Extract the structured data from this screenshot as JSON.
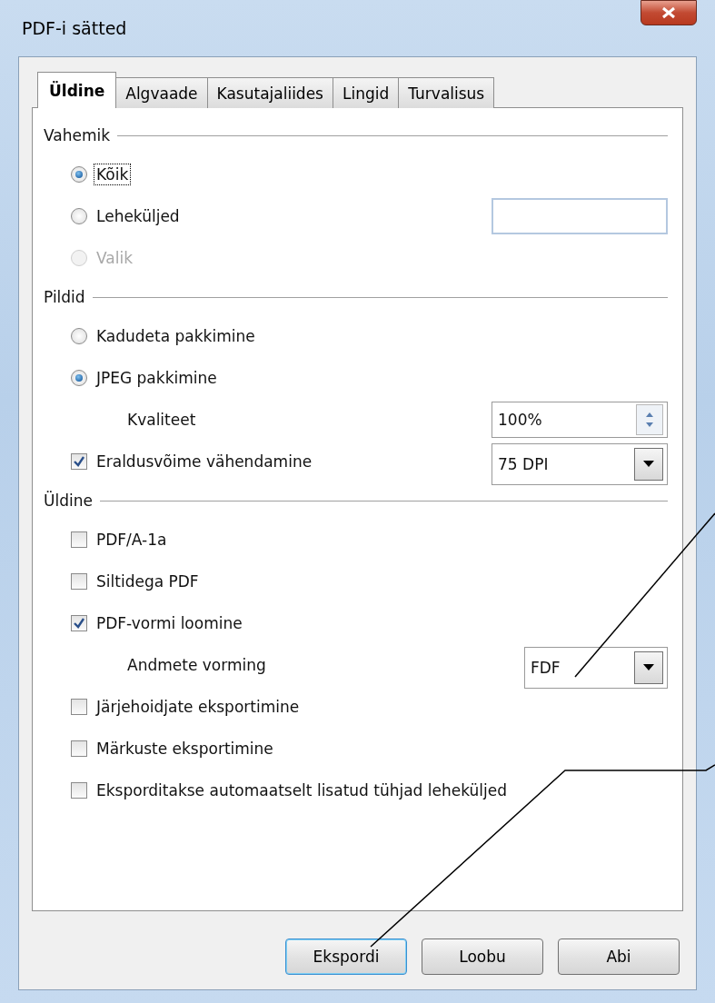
{
  "window": {
    "title": "PDF-i sätted"
  },
  "tabs": [
    {
      "label": "Üldine",
      "selected": true
    },
    {
      "label": "Algvaade",
      "selected": false
    },
    {
      "label": "Kasutajaliides",
      "selected": false
    },
    {
      "label": "Lingid",
      "selected": false
    },
    {
      "label": "Turvalisus",
      "selected": false
    }
  ],
  "sections": [
    {
      "title": "Vahemik",
      "items": [
        {
          "kind": "radio",
          "label": "Kõik",
          "selected": true,
          "disabled": false,
          "focused": true
        },
        {
          "kind": "radio",
          "label": "Leheküljed",
          "selected": false,
          "disabled": false,
          "control": {
            "kind": "text"
          }
        },
        {
          "kind": "radio",
          "label": "Valik",
          "selected": false,
          "disabled": true
        }
      ]
    },
    {
      "title": "Pildid",
      "items": [
        {
          "kind": "radio",
          "label": "Kadudeta pakkimine",
          "selected": false,
          "disabled": false
        },
        {
          "kind": "radio",
          "label": "JPEG pakkimine",
          "selected": true,
          "disabled": false,
          "children": [
            {
              "label": "Kvaliteet",
              "control": {
                "kind": "spin",
                "value": "100%"
              }
            }
          ]
        },
        {
          "kind": "checkbox",
          "label": "Eraldusvõime vähendamine",
          "checked": true,
          "control": {
            "kind": "dropdown",
            "value": "75 DPI"
          }
        }
      ]
    },
    {
      "title": "Üldine",
      "items": [
        {
          "kind": "checkbox",
          "label": "PDF/A-1a",
          "checked": false
        },
        {
          "kind": "checkbox",
          "label": "Siltidega PDF",
          "checked": false
        },
        {
          "kind": "checkbox",
          "label": "PDF-vormi loomine",
          "checked": true,
          "children": [
            {
              "label": "Andmete vorming",
              "control": {
                "kind": "dropdown",
                "value": "FDF",
                "narrow": true
              }
            }
          ]
        },
        {
          "kind": "checkbox",
          "label": "Järjehoidjate eksportimine",
          "checked": false
        },
        {
          "kind": "checkbox",
          "label": "Märkuste eksportimine",
          "checked": false
        },
        {
          "kind": "checkbox",
          "label": "Eksporditakse automaatselt lisatud tühjad leheküljed",
          "checked": false
        }
      ]
    }
  ],
  "buttons": [
    {
      "label": "Ekspordi",
      "default": true
    },
    {
      "label": "Loobu",
      "default": false
    },
    {
      "label": "Abi",
      "default": false
    }
  ]
}
